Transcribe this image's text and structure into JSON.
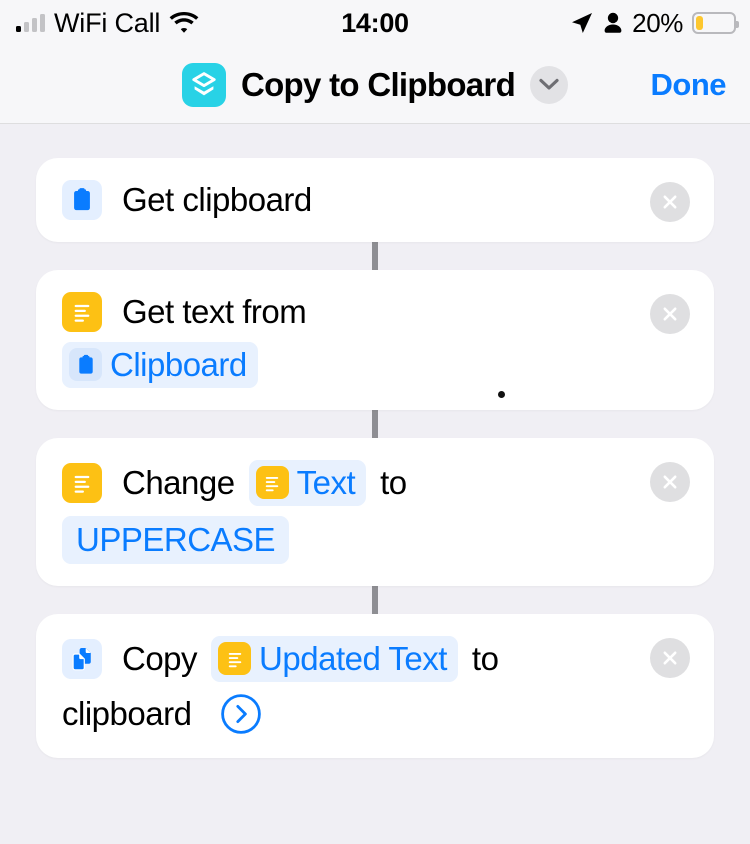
{
  "status_bar": {
    "carrier": "WiFi Call",
    "signal_bars_filled": 1,
    "signal_bars_total": 4,
    "wifi_icon": "wifi-icon",
    "time": "14:00",
    "location_icon": "location-arrow-icon",
    "person_icon": "person-icon",
    "battery_percent": "20%",
    "battery_level": 20,
    "battery_color": "#fdc72f"
  },
  "navbar": {
    "app_icon": "shortcuts-layers-icon",
    "app_icon_color": "#28d2e6",
    "title": "Copy to Clipboard",
    "chevron_icon": "chevron-down-icon",
    "done_label": "Done",
    "done_color": "#0a7cff"
  },
  "workflow": {
    "actions": [
      {
        "id": "get-clipboard",
        "icon": "clipboard-icon",
        "icon_color": "#0a7cff",
        "icon_bg": "#e4efff",
        "delete_icon": "close-icon",
        "lines": [
          {
            "parts": [
              {
                "type": "text",
                "value": "Get clipboard"
              }
            ]
          }
        ]
      },
      {
        "id": "get-text-from",
        "icon": "text-lines-icon",
        "icon_color": "#ffffff",
        "icon_bg": "#fdc114",
        "delete_icon": "close-icon",
        "lines": [
          {
            "parts": [
              {
                "type": "text",
                "value": "Get text from"
              }
            ]
          },
          {
            "parts": [
              {
                "type": "token",
                "value": "Clipboard",
                "token_icon": "clipboard-icon",
                "token_icon_bg": "#d7e6fb"
              }
            ]
          }
        ]
      },
      {
        "id": "change-case",
        "icon": "text-lines-icon",
        "icon_color": "#ffffff",
        "icon_bg": "#fdc114",
        "delete_icon": "close-icon",
        "lines": [
          {
            "parts": [
              {
                "type": "text",
                "value": "Change"
              },
              {
                "type": "token",
                "value": "Text",
                "token_icon": "text-lines-icon",
                "token_icon_bg": "#fdc114"
              },
              {
                "type": "text",
                "value": "to"
              }
            ]
          },
          {
            "parts": [
              {
                "type": "token_plain",
                "value": "UPPERCASE"
              }
            ]
          }
        ]
      },
      {
        "id": "copy-to-clipboard",
        "icon": "copy-documents-icon",
        "icon_color": "#0a7cff",
        "icon_bg": "#e4efff",
        "delete_icon": "close-icon",
        "lines": [
          {
            "parts": [
              {
                "type": "text",
                "value": "Copy"
              },
              {
                "type": "token",
                "value": "Updated Text",
                "token_icon": "text-lines-icon",
                "token_icon_bg": "#fdc114"
              },
              {
                "type": "text",
                "value": "to"
              }
            ]
          },
          {
            "parts": [
              {
                "type": "text",
                "value": "clipboard"
              },
              {
                "type": "expand",
                "value": "chevron-right-circle-icon"
              }
            ]
          }
        ]
      }
    ]
  }
}
